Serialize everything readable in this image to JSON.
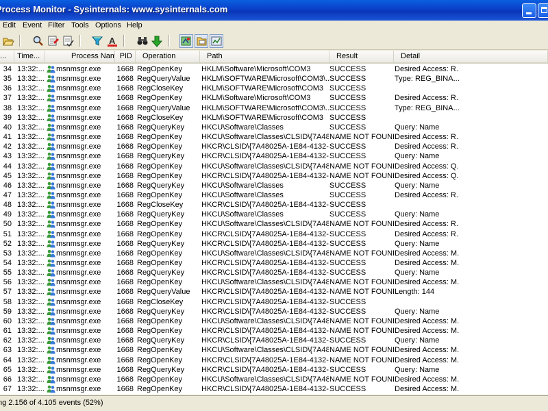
{
  "window": {
    "title": "Process Monitor - Sysinternals: www.sysinternals.com"
  },
  "menu": [
    "Edit",
    "Event",
    "Filter",
    "Tools",
    "Options",
    "Help"
  ],
  "toolbar": {
    "icons": [
      "open-folder-icon",
      "find-icon",
      "highlight-icon",
      "filter-edit-icon",
      "filter-icon",
      "text-color-icon",
      "binoculars-icon",
      "jump-arrow-icon",
      "registry-activity-icon",
      "filesystem-activity-icon",
      "process-activity-icon"
    ],
    "colors": {
      "highlight": "#1c5ee8",
      "success_green": "#2aa52a",
      "error_red": "#d81e1e"
    }
  },
  "columns": [
    "...",
    "Time...",
    "Process Name",
    "PID",
    "Operation",
    "Path",
    "Result",
    "Detail"
  ],
  "rows": [
    {
      "seq": "34",
      "time": "13:32:...",
      "process": "msnmsgr.exe",
      "pid": "1668",
      "op": "RegOpenKey",
      "path": "HKLM\\Software\\Microsoft\\COM3",
      "result": "SUCCESS",
      "detail": "Desired Access: R..."
    },
    {
      "seq": "35",
      "time": "13:32:...",
      "process": "msnmsgr.exe",
      "pid": "1668",
      "op": "RegQueryValue",
      "path": "HKLM\\SOFTWARE\\Microsoft\\COM3\\...",
      "result": "SUCCESS",
      "detail": "Type: REG_BINA..."
    },
    {
      "seq": "36",
      "time": "13:32:...",
      "process": "msnmsgr.exe",
      "pid": "1668",
      "op": "RegCloseKey",
      "path": "HKLM\\SOFTWARE\\Microsoft\\COM3",
      "result": "SUCCESS",
      "detail": ""
    },
    {
      "seq": "37",
      "time": "13:32:...",
      "process": "msnmsgr.exe",
      "pid": "1668",
      "op": "RegOpenKey",
      "path": "HKLM\\Software\\Microsoft\\COM3",
      "result": "SUCCESS",
      "detail": "Desired Access: R..."
    },
    {
      "seq": "38",
      "time": "13:32:...",
      "process": "msnmsgr.exe",
      "pid": "1668",
      "op": "RegQueryValue",
      "path": "HKLM\\SOFTWARE\\Microsoft\\COM3\\...",
      "result": "SUCCESS",
      "detail": "Type: REG_BINA..."
    },
    {
      "seq": "39",
      "time": "13:32:...",
      "process": "msnmsgr.exe",
      "pid": "1668",
      "op": "RegCloseKey",
      "path": "HKLM\\SOFTWARE\\Microsoft\\COM3",
      "result": "SUCCESS",
      "detail": ""
    },
    {
      "seq": "40",
      "time": "13:32:...",
      "process": "msnmsgr.exe",
      "pid": "1668",
      "op": "RegQueryKey",
      "path": "HKCU\\Software\\Classes",
      "result": "SUCCESS",
      "detail": "Query: Name"
    },
    {
      "seq": "41",
      "time": "13:32:...",
      "process": "msnmsgr.exe",
      "pid": "1668",
      "op": "RegOpenKey",
      "path": "HKCU\\Software\\Classes\\CLSID\\{7A48...",
      "result": "NAME NOT FOUND",
      "detail": "Desired Access: R..."
    },
    {
      "seq": "42",
      "time": "13:32:...",
      "process": "msnmsgr.exe",
      "pid": "1668",
      "op": "RegOpenKey",
      "path": "HKCR\\CLSID\\{7A48025A-1E84-4132-B...",
      "result": "SUCCESS",
      "detail": "Desired Access: R..."
    },
    {
      "seq": "43",
      "time": "13:32:...",
      "process": "msnmsgr.exe",
      "pid": "1668",
      "op": "RegQueryKey",
      "path": "HKCR\\CLSID\\{7A48025A-1E84-4132-B...",
      "result": "SUCCESS",
      "detail": "Query: Name"
    },
    {
      "seq": "44",
      "time": "13:32:...",
      "process": "msnmsgr.exe",
      "pid": "1668",
      "op": "RegOpenKey",
      "path": "HKCU\\Software\\Classes\\CLSID\\{7A48...",
      "result": "NAME NOT FOUND",
      "detail": "Desired Access: Q..."
    },
    {
      "seq": "45",
      "time": "13:32:...",
      "process": "msnmsgr.exe",
      "pid": "1668",
      "op": "RegOpenKey",
      "path": "HKCR\\CLSID\\{7A48025A-1E84-4132-B...",
      "result": "NAME NOT FOUND",
      "detail": "Desired Access: Q..."
    },
    {
      "seq": "46",
      "time": "13:32:...",
      "process": "msnmsgr.exe",
      "pid": "1668",
      "op": "RegQueryKey",
      "path": "HKCU\\Software\\Classes",
      "result": "SUCCESS",
      "detail": "Query: Name"
    },
    {
      "seq": "47",
      "time": "13:32:...",
      "process": "msnmsgr.exe",
      "pid": "1668",
      "op": "RegOpenKey",
      "path": "HKCU\\Software\\Classes",
      "result": "SUCCESS",
      "detail": "Desired Access: R..."
    },
    {
      "seq": "48",
      "time": "13:32:...",
      "process": "msnmsgr.exe",
      "pid": "1668",
      "op": "RegCloseKey",
      "path": "HKCR\\CLSID\\{7A48025A-1E84-4132-B...",
      "result": "SUCCESS",
      "detail": ""
    },
    {
      "seq": "49",
      "time": "13:32:...",
      "process": "msnmsgr.exe",
      "pid": "1668",
      "op": "RegQueryKey",
      "path": "HKCU\\Software\\Classes",
      "result": "SUCCESS",
      "detail": "Query: Name"
    },
    {
      "seq": "50",
      "time": "13:32:...",
      "process": "msnmsgr.exe",
      "pid": "1668",
      "op": "RegOpenKey",
      "path": "HKCU\\Software\\Classes\\CLSID\\{7A48...",
      "result": "NAME NOT FOUND",
      "detail": "Desired Access: R..."
    },
    {
      "seq": "51",
      "time": "13:32:...",
      "process": "msnmsgr.exe",
      "pid": "1668",
      "op": "RegOpenKey",
      "path": "HKCR\\CLSID\\{7A48025A-1E84-4132-B...",
      "result": "SUCCESS",
      "detail": "Desired Access: R..."
    },
    {
      "seq": "52",
      "time": "13:32:...",
      "process": "msnmsgr.exe",
      "pid": "1668",
      "op": "RegQueryKey",
      "path": "HKCR\\CLSID\\{7A48025A-1E84-4132-B...",
      "result": "SUCCESS",
      "detail": "Query: Name"
    },
    {
      "seq": "53",
      "time": "13:32:...",
      "process": "msnmsgr.exe",
      "pid": "1668",
      "op": "RegOpenKey",
      "path": "HKCU\\Software\\Classes\\CLSID\\{7A48...",
      "result": "NAME NOT FOUND",
      "detail": "Desired Access: M..."
    },
    {
      "seq": "54",
      "time": "13:32:...",
      "process": "msnmsgr.exe",
      "pid": "1668",
      "op": "RegOpenKey",
      "path": "HKCR\\CLSID\\{7A48025A-1E84-4132-B...",
      "result": "SUCCESS",
      "detail": "Desired Access: M..."
    },
    {
      "seq": "55",
      "time": "13:32:...",
      "process": "msnmsgr.exe",
      "pid": "1668",
      "op": "RegQueryKey",
      "path": "HKCR\\CLSID\\{7A48025A-1E84-4132-B...",
      "result": "SUCCESS",
      "detail": "Query: Name"
    },
    {
      "seq": "56",
      "time": "13:32:...",
      "process": "msnmsgr.exe",
      "pid": "1668",
      "op": "RegOpenKey",
      "path": "HKCU\\Software\\Classes\\CLSID\\{7A48...",
      "result": "NAME NOT FOUND",
      "detail": "Desired Access: M..."
    },
    {
      "seq": "57",
      "time": "13:32:...",
      "process": "msnmsgr.exe",
      "pid": "1668",
      "op": "RegQueryValue",
      "path": "HKCR\\CLSID\\{7A48025A-1E84-4132-B...",
      "result": "NAME NOT FOUND",
      "detail": "Length: 144"
    },
    {
      "seq": "58",
      "time": "13:32:...",
      "process": "msnmsgr.exe",
      "pid": "1668",
      "op": "RegCloseKey",
      "path": "HKCR\\CLSID\\{7A48025A-1E84-4132-B...",
      "result": "SUCCESS",
      "detail": ""
    },
    {
      "seq": "59",
      "time": "13:32:...",
      "process": "msnmsgr.exe",
      "pid": "1668",
      "op": "RegQueryKey",
      "path": "HKCR\\CLSID\\{7A48025A-1E84-4132-B...",
      "result": "SUCCESS",
      "detail": "Query: Name"
    },
    {
      "seq": "60",
      "time": "13:32:...",
      "process": "msnmsgr.exe",
      "pid": "1668",
      "op": "RegOpenKey",
      "path": "HKCU\\Software\\Classes\\CLSID\\{7A48...",
      "result": "NAME NOT FOUND",
      "detail": "Desired Access: M..."
    },
    {
      "seq": "61",
      "time": "13:32:...",
      "process": "msnmsgr.exe",
      "pid": "1668",
      "op": "RegOpenKey",
      "path": "HKCR\\CLSID\\{7A48025A-1E84-4132-B...",
      "result": "NAME NOT FOUND",
      "detail": "Desired Access: M..."
    },
    {
      "seq": "62",
      "time": "13:32:...",
      "process": "msnmsgr.exe",
      "pid": "1668",
      "op": "RegQueryKey",
      "path": "HKCR\\CLSID\\{7A48025A-1E84-4132-B...",
      "result": "SUCCESS",
      "detail": "Query: Name"
    },
    {
      "seq": "63",
      "time": "13:32:...",
      "process": "msnmsgr.exe",
      "pid": "1668",
      "op": "RegOpenKey",
      "path": "HKCU\\Software\\Classes\\CLSID\\{7A48...",
      "result": "NAME NOT FOUND",
      "detail": "Desired Access: M..."
    },
    {
      "seq": "64",
      "time": "13:32:...",
      "process": "msnmsgr.exe",
      "pid": "1668",
      "op": "RegOpenKey",
      "path": "HKCR\\CLSID\\{7A48025A-1E84-4132-B...",
      "result": "NAME NOT FOUND",
      "detail": "Desired Access: M..."
    },
    {
      "seq": "65",
      "time": "13:32:...",
      "process": "msnmsgr.exe",
      "pid": "1668",
      "op": "RegQueryKey",
      "path": "HKCR\\CLSID\\{7A48025A-1E84-4132-B...",
      "result": "SUCCESS",
      "detail": "Query: Name"
    },
    {
      "seq": "66",
      "time": "13:32:...",
      "process": "msnmsgr.exe",
      "pid": "1668",
      "op": "RegOpenKey",
      "path": "HKCU\\Software\\Classes\\CLSID\\{7A48...",
      "result": "NAME NOT FOUND",
      "detail": "Desired Access: M..."
    },
    {
      "seq": "67",
      "time": "13:32:...",
      "process": "msnmsgr.exe",
      "pid": "1668",
      "op": "RegOpenKey",
      "path": "HKCR\\CLSID\\{7A48025A-1E84-4132-B...",
      "result": "SUCCESS",
      "detail": "Desired Access: M..."
    }
  ],
  "status": "ng 2.156 of 4.105 events (52%)"
}
